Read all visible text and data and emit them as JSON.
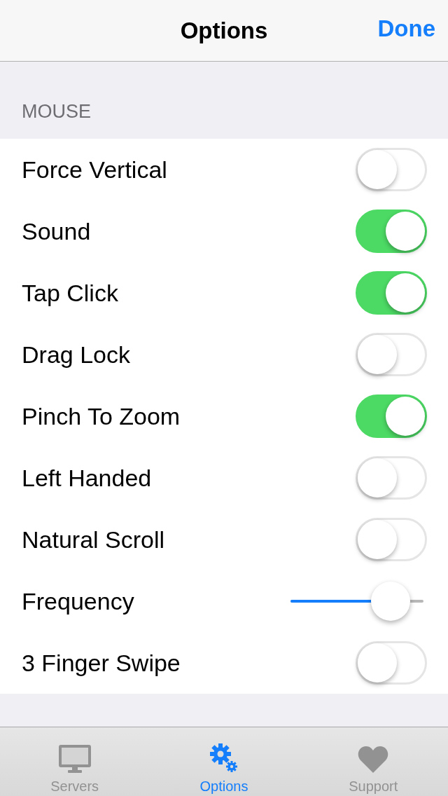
{
  "nav": {
    "title": "Options",
    "done": "Done"
  },
  "section": {
    "header": "MOUSE"
  },
  "rows": [
    {
      "kind": "toggle",
      "label": "Force Vertical",
      "on": false
    },
    {
      "kind": "toggle",
      "label": "Sound",
      "on": true
    },
    {
      "kind": "toggle",
      "label": "Tap Click",
      "on": true
    },
    {
      "kind": "toggle",
      "label": "Drag Lock",
      "on": false
    },
    {
      "kind": "toggle",
      "label": "Pinch To Zoom",
      "on": true
    },
    {
      "kind": "toggle",
      "label": "Left Handed",
      "on": false
    },
    {
      "kind": "toggle",
      "label": "Natural Scroll",
      "on": false
    },
    {
      "kind": "slider",
      "label": "Frequency",
      "level": 0.75
    },
    {
      "kind": "toggle",
      "label": "3 Finger Swipe",
      "on": false
    }
  ],
  "tabs": [
    {
      "kind": "monitor",
      "label": "Servers",
      "selected": false
    },
    {
      "kind": "gears",
      "label": "Options",
      "selected": true
    },
    {
      "kind": "heart",
      "label": "Support",
      "selected": false
    }
  ]
}
